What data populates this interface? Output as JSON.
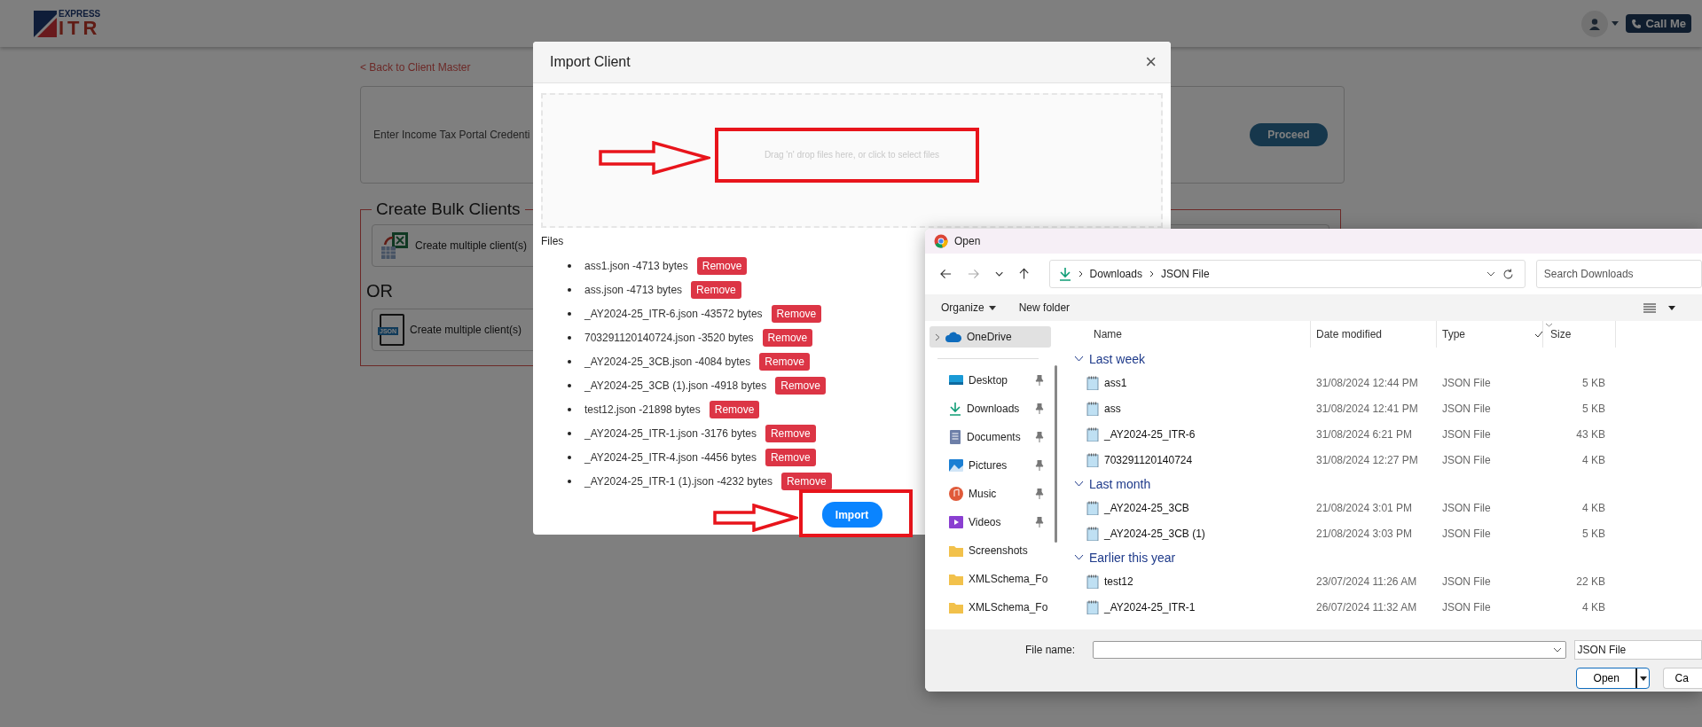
{
  "header": {
    "logo_top": "EXPRESS",
    "logo_bottom": "ITR",
    "call_button": "Call Me"
  },
  "page": {
    "back_link": "< Back to Client Master",
    "credentials_label": "Enter Income Tax Portal Credenti",
    "proceed_button": "Proceed",
    "bulk_title": "Create Bulk Clients",
    "or_text": "OR",
    "options": [
      {
        "kind": "excel",
        "label": "Create multiple client(s)"
      },
      {
        "kind": "json",
        "label": "Create multiple client(s)",
        "icon_text": "JSON"
      }
    ]
  },
  "modal": {
    "title": "Import Client",
    "close": "×",
    "dropzone_text": "Drag 'n' drop files here, or click to select files",
    "files_label": "Files",
    "import_button": "Import",
    "files": [
      {
        "name": "ass1.json -4713 bytes",
        "action": "Remove"
      },
      {
        "name": "ass.json -4713 bytes",
        "action": "Remove"
      },
      {
        "name": "_AY2024-25_ITR-6.json -43572 bytes",
        "action": "Remove"
      },
      {
        "name": "703291120140724.json -3520 bytes",
        "action": "Remove"
      },
      {
        "name": "_AY2024-25_3CB.json -4084 bytes",
        "action": "Remove"
      },
      {
        "name": "_AY2024-25_3CB (1).json -4918 bytes",
        "action": "Remove"
      },
      {
        "name": "test12.json -21898 bytes",
        "action": "Remove"
      },
      {
        "name": "_AY2024-25_ITR-1.json -3176 bytes",
        "action": "Remove"
      },
      {
        "name": "_AY2024-25_ITR-4.json -4456 bytes",
        "action": "Remove"
      },
      {
        "name": "_AY2024-25_ITR-1 (1).json -4232 bytes",
        "action": "Remove"
      }
    ]
  },
  "dialog": {
    "title": "Open",
    "path": [
      "Downloads",
      "JSON File"
    ],
    "search_placeholder": "Search Downloads",
    "organize": "Organize",
    "new_folder": "New folder",
    "nav": [
      {
        "label": "OneDrive",
        "kind": "cloud",
        "selected": true,
        "pinned": false
      },
      {
        "label": "Desktop",
        "kind": "desktop",
        "selected": false,
        "pinned": true
      },
      {
        "label": "Downloads",
        "kind": "download",
        "selected": false,
        "pinned": true
      },
      {
        "label": "Documents",
        "kind": "document",
        "selected": false,
        "pinned": true
      },
      {
        "label": "Pictures",
        "kind": "pictures",
        "selected": false,
        "pinned": true
      },
      {
        "label": "Music",
        "kind": "music",
        "selected": false,
        "pinned": true
      },
      {
        "label": "Videos",
        "kind": "videos",
        "selected": false,
        "pinned": true
      },
      {
        "label": "Screenshots",
        "kind": "folder",
        "selected": false,
        "pinned": false
      },
      {
        "label": "XMLSchema_Fo",
        "kind": "folder",
        "selected": false,
        "pinned": false
      },
      {
        "label": "XMLSchema_Fo",
        "kind": "folder",
        "selected": false,
        "pinned": false
      }
    ],
    "columns": [
      "Name",
      "Date modified",
      "Type",
      "Size"
    ],
    "groups": [
      {
        "label": "Last week",
        "files": [
          {
            "name": "ass1",
            "date": "31/08/2024 12:44 PM",
            "type": "JSON File",
            "size": "5 KB"
          },
          {
            "name": "ass",
            "date": "31/08/2024 12:41 PM",
            "type": "JSON File",
            "size": "5 KB"
          },
          {
            "name": "_AY2024-25_ITR-6",
            "date": "31/08/2024 6:21 PM",
            "type": "JSON File",
            "size": "43 KB"
          },
          {
            "name": "703291120140724",
            "date": "31/08/2024 12:27 PM",
            "type": "JSON File",
            "size": "4 KB"
          }
        ]
      },
      {
        "label": "Last month",
        "files": [
          {
            "name": "_AY2024-25_3CB",
            "date": "21/08/2024 3:01 PM",
            "type": "JSON File",
            "size": "4 KB"
          },
          {
            "name": "_AY2024-25_3CB (1)",
            "date": "21/08/2024 3:03 PM",
            "type": "JSON File",
            "size": "5 KB"
          }
        ]
      },
      {
        "label": "Earlier this year",
        "files": [
          {
            "name": "test12",
            "date": "23/07/2024 11:26 AM",
            "type": "JSON File",
            "size": "22 KB"
          },
          {
            "name": "_AY2024-25_ITR-1",
            "date": "26/07/2024 11:32 AM",
            "type": "JSON File",
            "size": "4 KB"
          }
        ]
      }
    ],
    "file_name_label": "File name:",
    "file_type": "JSON File",
    "open_button": "Open",
    "cancel_button": "Ca"
  }
}
